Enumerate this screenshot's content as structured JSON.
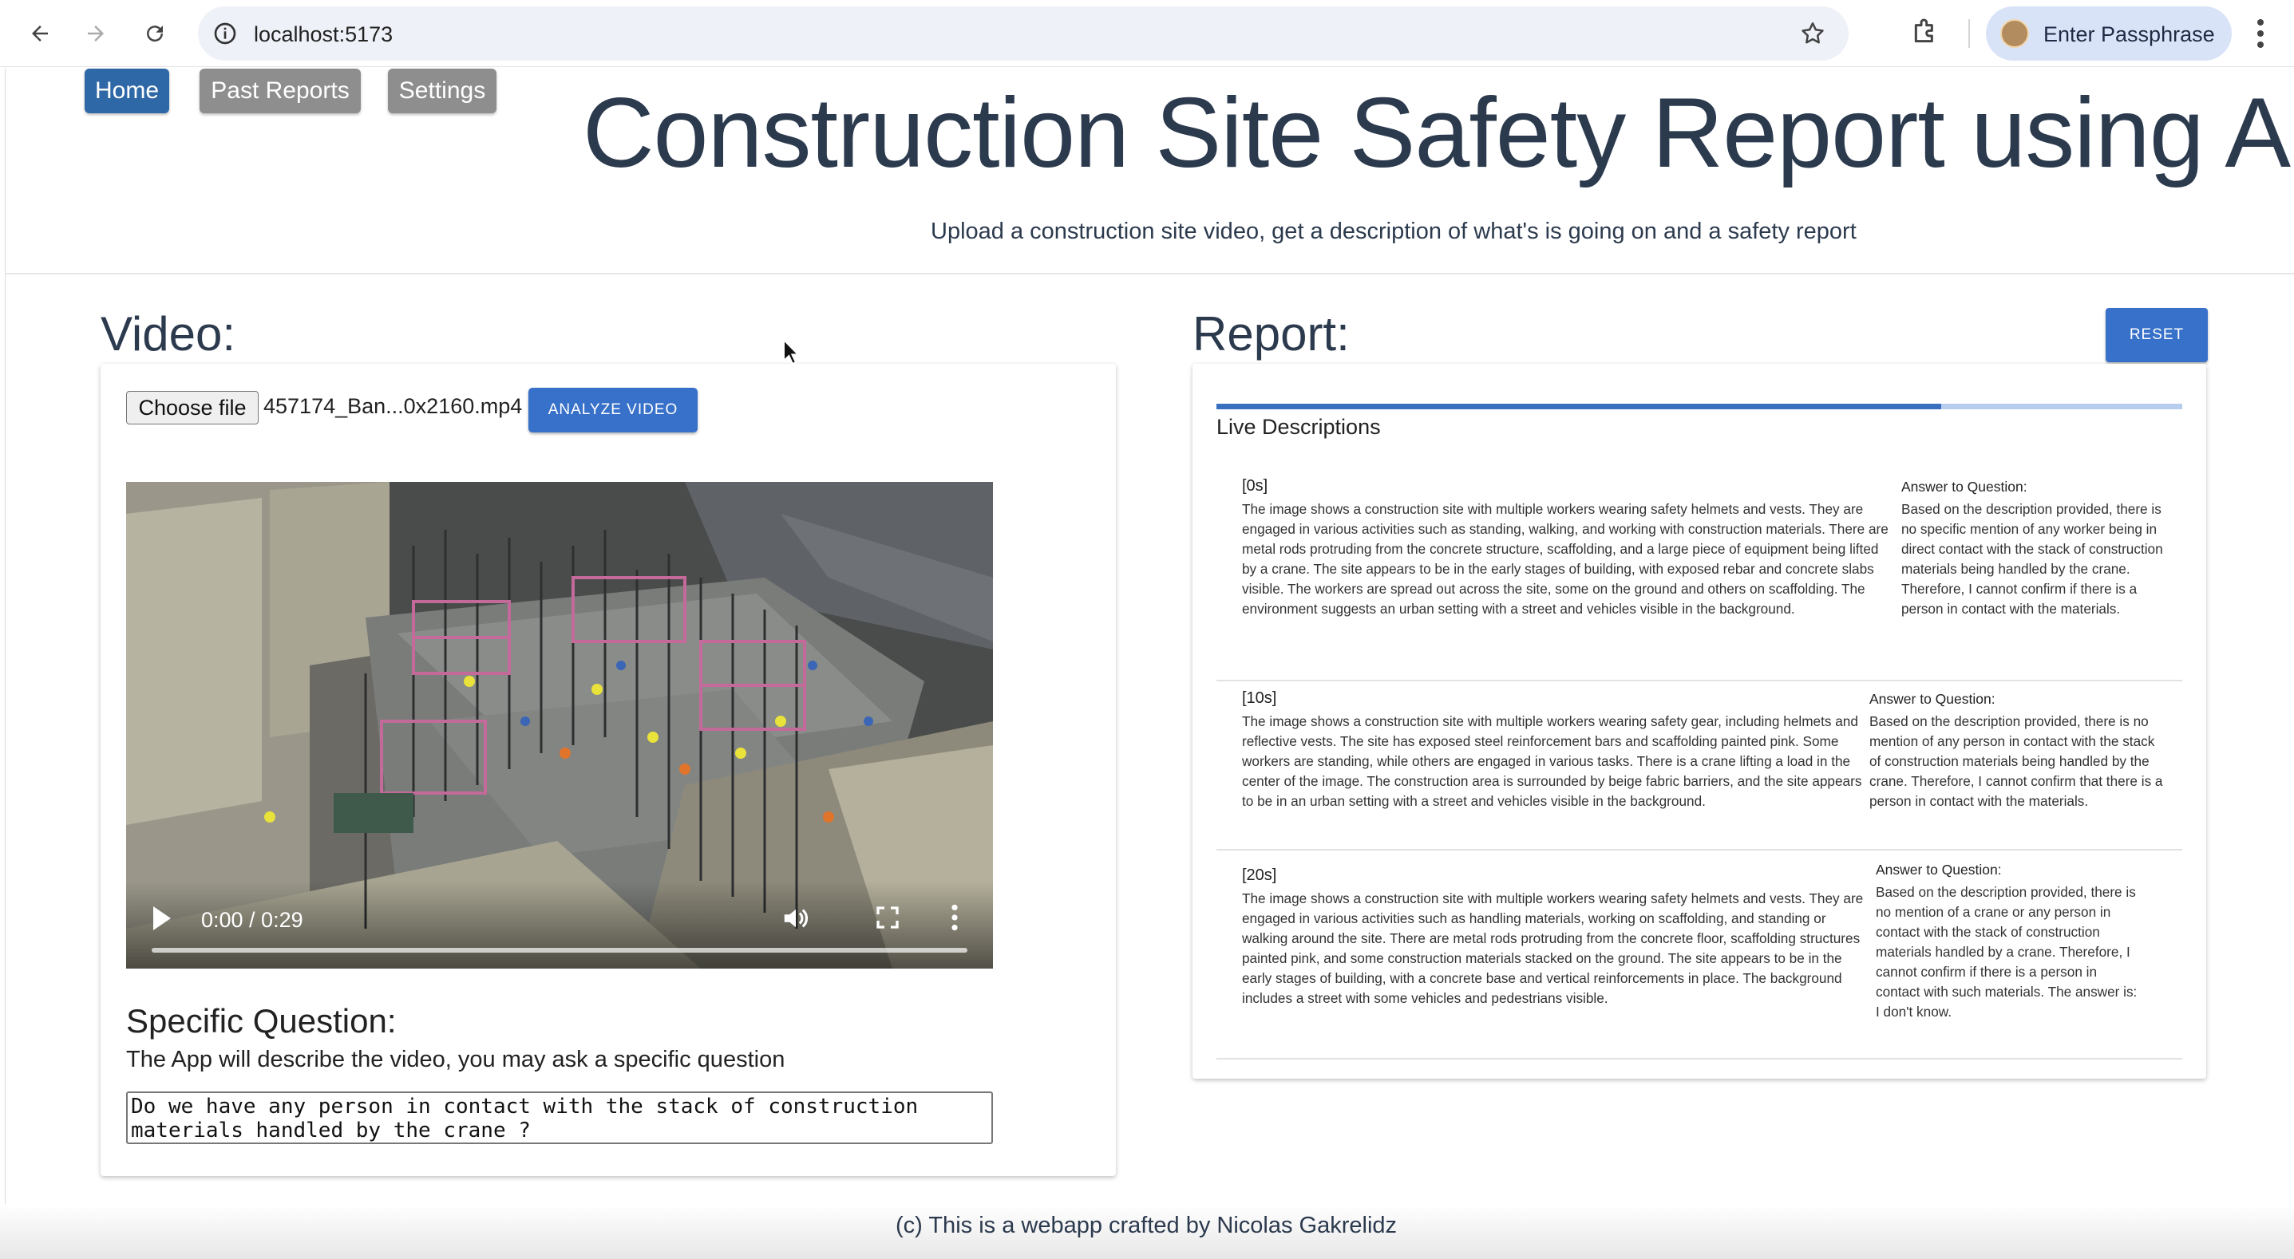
{
  "browser": {
    "url": "localhost:5173",
    "profile_label": "Enter Passphrase"
  },
  "nav": {
    "home": "Home",
    "past_reports": "Past Reports",
    "settings": "Settings"
  },
  "header": {
    "title": "Construction Site Safety Report using AI",
    "subtitle": "Upload a construction site video, get a description of what's is going on and a safety report"
  },
  "video_section": {
    "title": "Video:",
    "choose_file": "Choose file",
    "file_name": "457174_Ban...0x2160.mp4",
    "analyze_button": "ANALYZE VIDEO",
    "player": {
      "time": "0:00 / 0:29"
    },
    "question_title": "Specific Question:",
    "question_hint": "The App will describe the video, you may ask a specific question",
    "question_value": "Do we have any person in contact with the stack of construction\nmaterials handled by the crane ?"
  },
  "report_section": {
    "title": "Report:",
    "reset_button": "RESET",
    "progress": 0.75,
    "live_label": "Live Descriptions",
    "entries": [
      {
        "timestamp": "[0s]",
        "description": "The image shows a construction site with multiple workers wearing safety helmets and vests. They are engaged in various activities such as standing, walking, and working with construction materials. There are metal rods protruding from the concrete structure, scaffolding, and a large piece of equipment being lifted by a crane. The site appears to be in the early stages of building, with exposed rebar and concrete slabs visible. The workers are spread out across the site, some on the ground and others on scaffolding. The environment suggests an urban setting with a street and vehicles visible in the background.",
        "answer_title": "Answer to Question:",
        "answer": "Based on the description provided, there is no specific mention of any worker being in direct contact with the stack of construction materials being handled by the crane. Therefore, I cannot confirm if there is a person in contact with the materials."
      },
      {
        "timestamp": "[10s]",
        "description": "The image shows a construction site with multiple workers wearing safety gear, including helmets and reflective vests. The site has exposed steel reinforcement bars and scaffolding painted pink. Some workers are standing, while others are engaged in various tasks. There is a crane lifting a load in the center of the image. The construction area is surrounded by beige fabric barriers, and the site appears to be in an urban setting with a street and vehicles visible in the background.",
        "answer_title": "Answer to Question:",
        "answer": "Based on the description provided, there is no mention of any person in contact with the stack of construction materials being handled by the crane. Therefore, I cannot confirm that there is a person in contact with the materials."
      },
      {
        "timestamp": "[20s]",
        "description": "The image shows a construction site with multiple workers wearing safety helmets and vests. They are engaged in various activities such as handling materials, working on scaffolding, and standing or walking around the site. There are metal rods protruding from the concrete floor, scaffolding structures painted pink, and some construction materials stacked on the ground. The site appears to be in the early stages of building, with a concrete base and vertical reinforcements in place. The background includes a street with some vehicles and pedestrians visible.",
        "answer_title": "Answer to Question:",
        "answer": "Based on the description provided, there is no mention of a crane or any person in contact with the stack of construction materials handled by a crane. Therefore, I cannot confirm if there is a person in contact with such materials. The answer is: I don't know."
      }
    ]
  },
  "footer": {
    "text": "(c) This is a webapp crafted by Nicolas Gakrelidz"
  },
  "colors": {
    "primary": "#3871c9",
    "home_button": "#2f68a7",
    "secondary_button": "#8e8e8e",
    "title_text": "#2c3a4e"
  }
}
